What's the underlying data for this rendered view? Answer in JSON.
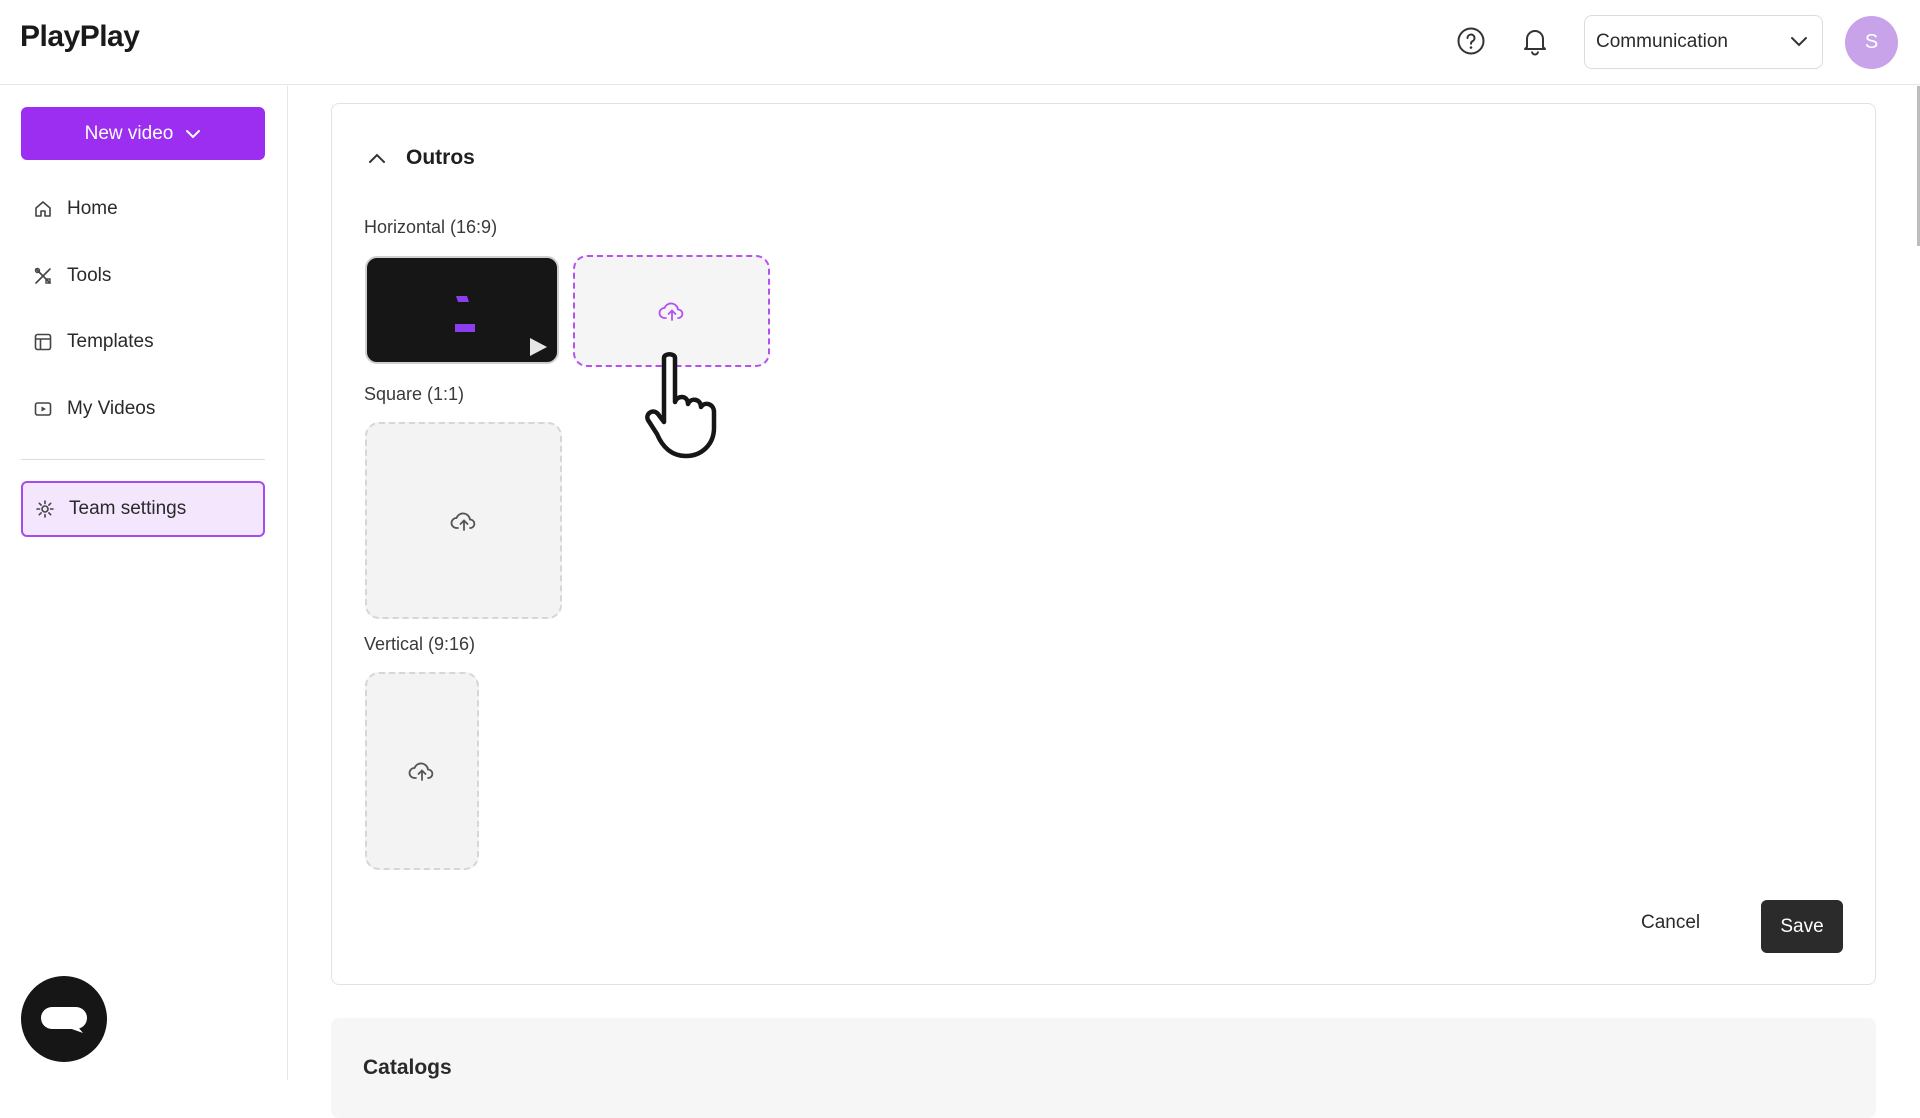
{
  "header": {
    "logo": "PlayPlay",
    "team_select": {
      "value": "Communication"
    },
    "avatar_initial": "S"
  },
  "sidebar": {
    "new_video_label": "New video",
    "items": [
      {
        "label": "Home",
        "icon": "home-icon"
      },
      {
        "label": "Tools",
        "icon": "tools-icon"
      },
      {
        "label": "Templates",
        "icon": "templates-icon"
      },
      {
        "label": "My Videos",
        "icon": "my-videos-icon"
      }
    ],
    "active_item": {
      "label": "Team settings",
      "icon": "gear-icon"
    }
  },
  "main": {
    "section_title": "Outros",
    "formats": [
      {
        "label": "Horizontal (16:9)"
      },
      {
        "label": "Square (1:1)"
      },
      {
        "label": "Vertical (9:16)"
      }
    ],
    "actions": {
      "cancel_label": "Cancel",
      "save_label": "Save"
    },
    "next_section_title": "Catalogs"
  },
  "colors": {
    "accent": "#9b2ef0",
    "accent_light": "#f3e6fd",
    "dark_button": "#2b2b2b"
  }
}
